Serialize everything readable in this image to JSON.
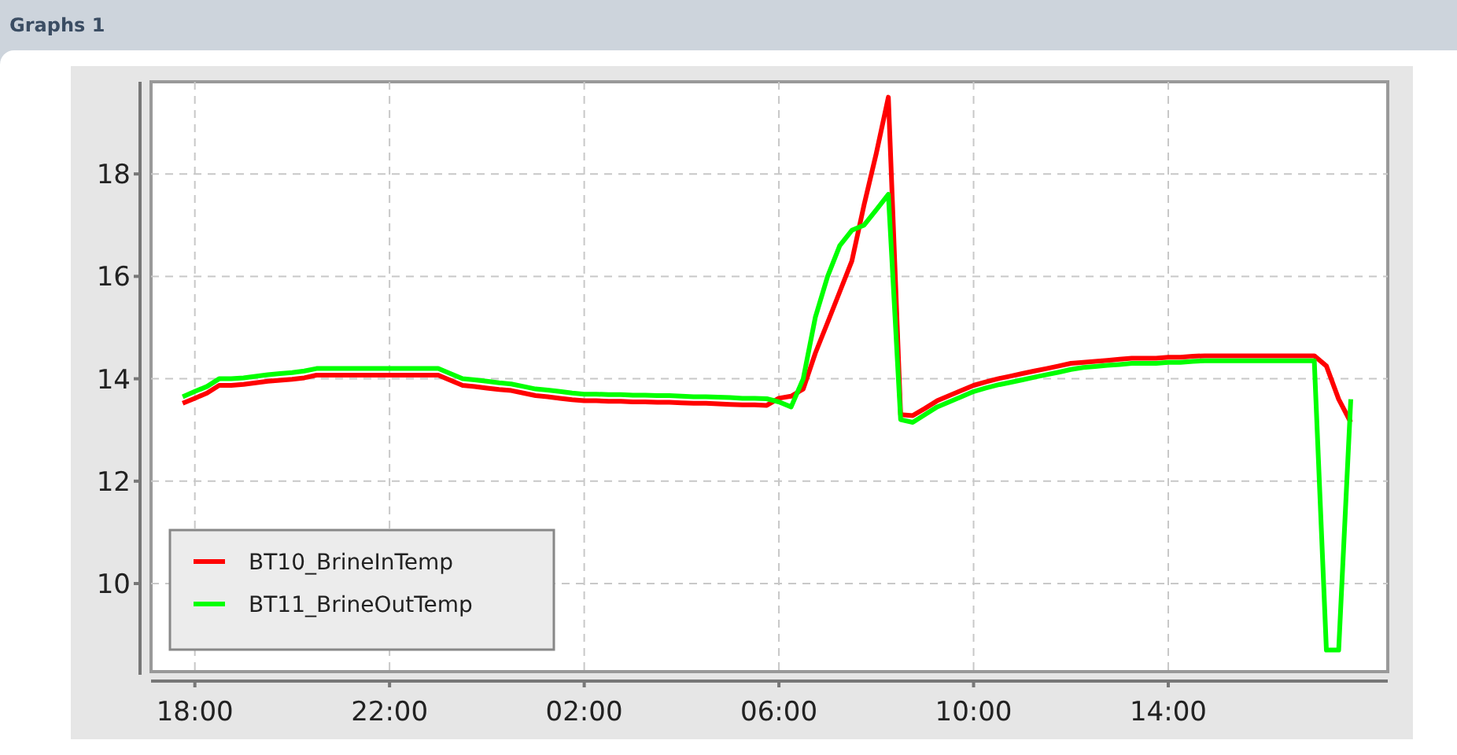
{
  "panel": {
    "title": "Graphs 1"
  },
  "chart": {
    "chart_data": {
      "type": "line",
      "categories": [
        null,
        "18:00",
        null,
        null,
        null,
        null,
        null,
        null,
        null,
        null,
        null,
        null,
        null,
        null,
        null,
        null,
        null,
        "22:00",
        null,
        null,
        null,
        null,
        null,
        null,
        null,
        null,
        null,
        null,
        null,
        null,
        null,
        null,
        null,
        "02:00",
        null,
        null,
        null,
        null,
        null,
        null,
        null,
        null,
        null,
        null,
        null,
        null,
        null,
        null,
        null,
        "06:00",
        null,
        null,
        null,
        null,
        null,
        null,
        null,
        null,
        null,
        null,
        null,
        null,
        null,
        null,
        null,
        "10:00",
        null,
        null,
        null,
        null,
        null,
        null,
        null,
        null,
        null,
        null,
        null,
        null,
        null,
        null,
        null,
        "14:00",
        null,
        null,
        null,
        null,
        null,
        null,
        null,
        null,
        null,
        null,
        null,
        null,
        null,
        null,
        null
      ],
      "series": [
        {
          "name": "BT10_BrineInTemp",
          "color": "#ff0000",
          "values": [
            13.52,
            13.62,
            13.72,
            13.87,
            13.87,
            13.89,
            13.92,
            13.95,
            13.97,
            13.99,
            14.02,
            14.07,
            14.07,
            14.07,
            14.07,
            14.07,
            14.07,
            14.07,
            14.07,
            14.07,
            14.07,
            14.07,
            13.97,
            13.87,
            13.85,
            13.82,
            13.79,
            13.77,
            13.72,
            13.67,
            13.65,
            13.62,
            13.59,
            13.57,
            13.57,
            13.56,
            13.56,
            13.55,
            13.55,
            13.54,
            13.54,
            13.53,
            13.52,
            13.52,
            13.51,
            13.5,
            13.49,
            13.49,
            13.48,
            13.62,
            13.66,
            13.8,
            14.5,
            15.1,
            15.7,
            16.3,
            17.4,
            18.4,
            19.5,
            13.3,
            13.28,
            13.42,
            13.57,
            13.67,
            13.77,
            13.87,
            13.94,
            14.0,
            14.05,
            14.1,
            14.15,
            14.2,
            14.25,
            14.3,
            14.32,
            14.34,
            14.36,
            14.38,
            14.4,
            14.4,
            14.4,
            14.42,
            14.42,
            14.44,
            14.45,
            14.45,
            14.45,
            14.45,
            14.45,
            14.45,
            14.45,
            14.45,
            14.45,
            14.45,
            14.25,
            13.6,
            13.15
          ]
        },
        {
          "name": "BT11_BrineOutTemp",
          "color": "#00ff00",
          "values": [
            13.65,
            13.75,
            13.85,
            14.0,
            14.0,
            14.02,
            14.05,
            14.08,
            14.1,
            14.12,
            14.15,
            14.2,
            14.2,
            14.2,
            14.2,
            14.2,
            14.2,
            14.2,
            14.2,
            14.2,
            14.2,
            14.2,
            14.1,
            14.0,
            13.98,
            13.95,
            13.92,
            13.9,
            13.85,
            13.8,
            13.78,
            13.75,
            13.72,
            13.7,
            13.7,
            13.69,
            13.69,
            13.68,
            13.68,
            13.67,
            13.67,
            13.66,
            13.65,
            13.65,
            13.64,
            13.63,
            13.62,
            13.62,
            13.61,
            13.55,
            13.45,
            14.0,
            15.2,
            16.0,
            16.6,
            16.9,
            17.0,
            17.3,
            17.6,
            13.2,
            13.15,
            13.3,
            13.45,
            13.55,
            13.65,
            13.75,
            13.82,
            13.88,
            13.93,
            13.98,
            14.03,
            14.08,
            14.13,
            14.18,
            14.22,
            14.24,
            14.26,
            14.28,
            14.3,
            14.3,
            14.3,
            14.32,
            14.32,
            14.34,
            14.35,
            14.35,
            14.35,
            14.35,
            14.35,
            14.35,
            14.35,
            14.35,
            14.35,
            14.35,
            8.7,
            8.7,
            13.6
          ]
        }
      ],
      "ylim": [
        8.28,
        19.8
      ],
      "yticks": [
        10,
        12,
        14,
        16,
        18
      ],
      "grid": true,
      "legend": true
    }
  }
}
